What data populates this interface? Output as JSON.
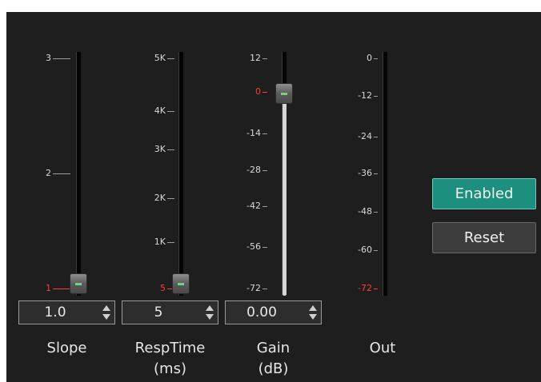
{
  "colors": {
    "background": "#1e1e1e",
    "accent": "#1c8f7e",
    "min_tick": "#ff3b3b",
    "thumb_grip": "#7bd07b"
  },
  "slope": {
    "ticks": [
      "3",
      "2",
      "1"
    ],
    "value": "1.0",
    "label": "Slope"
  },
  "resptime": {
    "ticks": [
      "5K",
      "4K",
      "3K",
      "2K",
      "1K",
      "5"
    ],
    "value": "5",
    "label_line1": "RespTime",
    "label_line2": "(ms)"
  },
  "gain": {
    "ticks": [
      "12",
      "0",
      "-14",
      "-28",
      "-42",
      "-56",
      "-72"
    ],
    "value": "0.00",
    "label_line1": "Gain",
    "label_line2": "(dB)"
  },
  "out": {
    "ticks": [
      "0",
      "-12",
      "-24",
      "-36",
      "-48",
      "-60",
      "-72"
    ],
    "label": "Out"
  },
  "buttons": {
    "enabled": "Enabled",
    "reset": "Reset"
  },
  "icons": {
    "spin_up": "triangle-up-icon",
    "spin_down": "triangle-down-icon",
    "thumb": "slider-thumb-icon"
  }
}
